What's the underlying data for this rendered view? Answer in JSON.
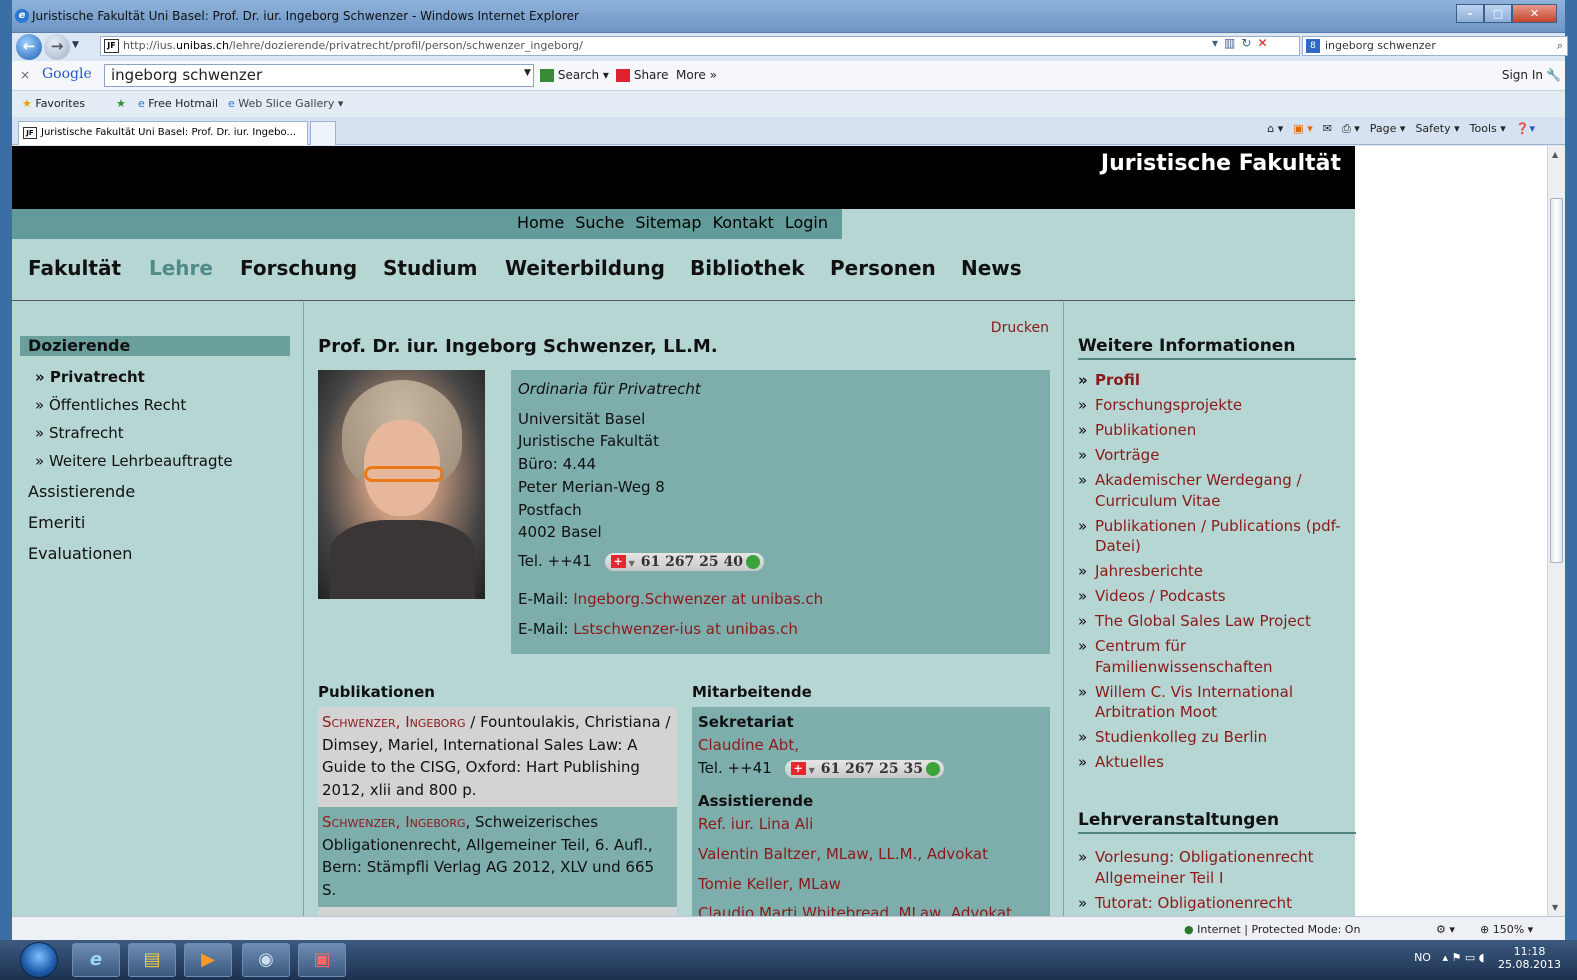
{
  "window": {
    "title": "Juristische Fakultät Uni Basel: Prof. Dr. iur. Ingeborg Schwenzer - Windows Internet Explorer",
    "url_prefix": "http://ius.",
    "url_host": "unibas.ch",
    "url_path": "/lehre/dozierende/privatrecht/profil/person/schwenzer_ingeborg/",
    "search_value": "ingeborg schwenzer"
  },
  "google_bar": {
    "close": "×",
    "logo": "Google",
    "query": "ingeborg schwenzer",
    "search": "Search",
    "share": "Share",
    "more": "More »",
    "sign_in": "Sign In"
  },
  "favorites_bar": {
    "favorites": "Favorites",
    "free_hotmail": "Free Hotmail",
    "web_slice": "Web Slice Gallery"
  },
  "tab": {
    "label": "Juristische Fakultät Uni Basel: Prof. Dr. iur. Ingebo..."
  },
  "command_bar": {
    "page": "Page ▾",
    "safety": "Safety ▾",
    "tools": "Tools ▾"
  },
  "site": {
    "faculty": "Juristische Fakultät",
    "top_nav": [
      "Home",
      "Suche",
      "Sitemap",
      "Kontakt",
      "Login"
    ],
    "main_nav": [
      "Fakultät",
      "Lehre",
      "Forschung",
      "Studium",
      "Weiterbildung",
      "Bibliothek",
      "Personen",
      "News"
    ],
    "left_nav": {
      "section": "Dozierende",
      "items": [
        "» Privatrecht",
        "» Öffentliches Recht",
        "» Strafrecht",
        "» Weitere Lehrbeauftragte"
      ],
      "others": [
        "Assistierende",
        "Emeriti",
        "Evaluationen"
      ]
    },
    "print": "Drucken",
    "person": {
      "name": "Prof. Dr. iur. Ingeborg Schwenzer, LL.M.",
      "role": "Ordinaria für Privatrecht",
      "address": [
        "Universität Basel",
        "Juristische Fakultät",
        "Büro: 4.44",
        "Peter Merian-Weg 8",
        "Postfach",
        "4002 Basel"
      ],
      "tel_label": "Tel. ++41",
      "tel": "61 267 25 40",
      "email_label": "E-Mail:",
      "email1": "Ingeborg.Schwenzer at unibas.ch",
      "email2": "Lstschwenzer-ius at unibas.ch"
    },
    "publications": {
      "heading": "Publikationen",
      "p1_authors": "Schwenzer, Ingeborg",
      "p1_rest": " / Fountoulakis, Christiana / Dimsey, Mariel, International Sales Law: A Guide to the CISG, Oxford: Hart Publishing 2012, xlii and 800 p.",
      "p2_authors": "Schwenzer, Ingeborg",
      "p2_rest": ", Schweizerisches Obligationenrecht, Allgemeiner Teil, 6. Aufl., Bern: Stämpfli Verlag AG 2012, XLV und 665 S."
    },
    "staff": {
      "heading": "Mitarbeitende",
      "secretariat": "Sekretariat",
      "secretary": "Claudine Abt,",
      "tel_label": "Tel. ++41",
      "tel": "61 267 25 35",
      "assistants_heading": "Assistierende",
      "assistants": [
        "Ref. iur. Lina Ali",
        "Valentin Baltzer, MLaw, LL.M., Advokat",
        "Tomie Keller, MLaw",
        "Claudio Marti Whitebread, MLaw, Advokat"
      ]
    },
    "right": {
      "heading1": "Weitere Informationen",
      "links": [
        "Profil",
        "Forschungsprojekte",
        "Publikationen",
        "Vorträge",
        "Akademischer Werdegang / Curriculum Vitae",
        "Publikationen / Publications (pdf-Datei)",
        "Jahresberichte",
        "Videos / Podcasts",
        "The Global Sales Law Project",
        "Centrum für Familienwissenschaften",
        "Willem C. Vis International Arbitration Moot",
        "Studienkolleg zu Berlin",
        "Aktuelles"
      ],
      "heading2": "Lehrveranstaltungen",
      "courses": [
        "Vorlesung: Obligationenrecht Allgemeiner Teil I",
        "Tutorat: Obligationenrecht"
      ]
    }
  },
  "status_bar": {
    "zone": "Internet | Protected Mode: On",
    "zoom": "150%"
  },
  "taskbar": {
    "lang": "NO",
    "time": "11:18",
    "date": "25.08.2013"
  }
}
